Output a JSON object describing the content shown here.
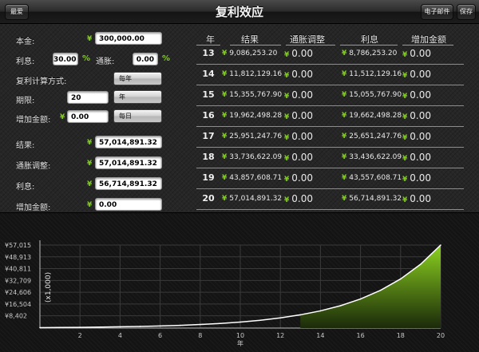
{
  "header": {
    "left_button": "最爱",
    "title": "复利效应",
    "email_button": "电子邮件",
    "save_button": "保存"
  },
  "form": {
    "principal": {
      "label": "本金:",
      "value": "300,000.00"
    },
    "interest": {
      "label": "利息:",
      "value": "30.00",
      "unit": "%"
    },
    "inflation": {
      "label": "通胀:",
      "value": "0.00",
      "unit": "%"
    },
    "compounding": {
      "label": "复利计算方式:",
      "value": "每年"
    },
    "term": {
      "label": "期限:",
      "value": "20",
      "unit_button": "年"
    },
    "addition": {
      "label": "增加金额:",
      "value": "0.00",
      "freq_button": "每日"
    },
    "currency_symbol": "¥",
    "results": [
      {
        "label": "结果:",
        "value": "57,014,891.32"
      },
      {
        "label": "通胀调整:",
        "value": "57,014,891.32"
      },
      {
        "label": "利息:",
        "value": "56,714,891.32"
      },
      {
        "label": "增加金额:",
        "value": "0.00"
      }
    ]
  },
  "table": {
    "headers": [
      "年",
      "结果",
      "通胀调整",
      "利息",
      "增加金额"
    ],
    "currency_symbol": "¥",
    "rows": [
      {
        "year": "13",
        "result": "9,086,253.20",
        "inflation_adj": "0.00",
        "interest": "8,786,253.20",
        "addition": "0.00"
      },
      {
        "year": "14",
        "result": "11,812,129.16",
        "inflation_adj": "0.00",
        "interest": "11,512,129.16",
        "addition": "0.00"
      },
      {
        "year": "15",
        "result": "15,355,767.90",
        "inflation_adj": "0.00",
        "interest": "15,055,767.90",
        "addition": "0.00"
      },
      {
        "year": "16",
        "result": "19,962,498.28",
        "inflation_adj": "0.00",
        "interest": "19,662,498.28",
        "addition": "0.00"
      },
      {
        "year": "17",
        "result": "25,951,247.76",
        "inflation_adj": "0.00",
        "interest": "25,651,247.76",
        "addition": "0.00"
      },
      {
        "year": "18",
        "result": "33,736,622.09",
        "inflation_adj": "0.00",
        "interest": "33,436,622.09",
        "addition": "0.00"
      },
      {
        "year": "19",
        "result": "43,857,608.71",
        "inflation_adj": "0.00",
        "interest": "43,557,608.71",
        "addition": "0.00"
      },
      {
        "year": "20",
        "result": "57,014,891.32",
        "inflation_adj": "0.00",
        "interest": "56,714,891.32",
        "addition": "0.00"
      }
    ]
  },
  "colors": {
    "accent_green": "#7fcf1a",
    "fill_green": "#6aa51a",
    "line_white": "#ffffff"
  },
  "chart_data": {
    "type": "area",
    "ylabel": "(x1,000)",
    "xlabel": "年",
    "x": [
      0,
      1,
      2,
      3,
      4,
      5,
      6,
      7,
      8,
      9,
      10,
      11,
      12,
      13,
      14,
      15,
      16,
      17,
      18,
      19,
      20
    ],
    "y": [
      300,
      390,
      507,
      659,
      857,
      1114,
      1448,
      1882,
      2447,
      3181,
      4136,
      5376,
      6989,
      9086,
      11812,
      15356,
      19962,
      25951,
      33737,
      43858,
      57015
    ],
    "xticks": [
      "2",
      "4",
      "6",
      "8",
      "10",
      "12",
      "14",
      "16",
      "18",
      "20"
    ],
    "yticks": [
      "¥57,015",
      "¥48,913",
      "¥40,811",
      "¥32,709",
      "¥24,606",
      "¥16,504",
      "¥8,402"
    ],
    "ytick_values": [
      57015,
      48913,
      40811,
      32709,
      24606,
      16504,
      8402
    ],
    "xlim": [
      0,
      20
    ],
    "ylim": [
      0,
      57015
    ],
    "fill_start_x": 13,
    "grid": true
  }
}
